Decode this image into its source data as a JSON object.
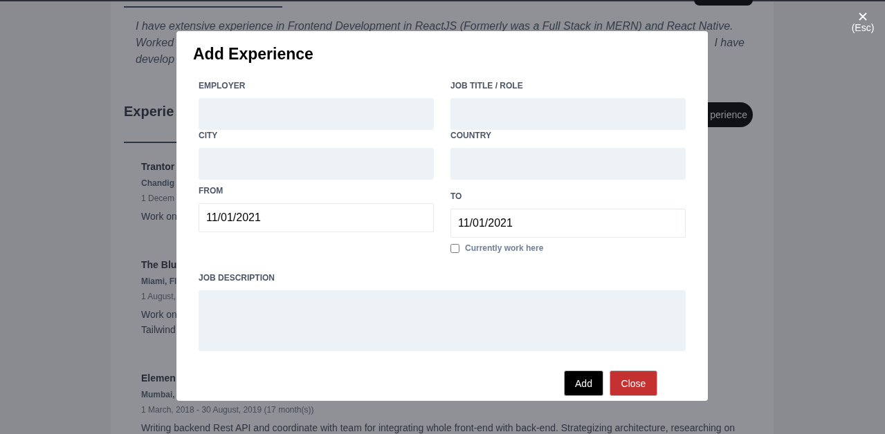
{
  "background_page": {
    "about_lines": [
      {
        "segments": [
          "I have extensive experience in Frontend Development in ReactJS (Formerly was a Full Stack in MERN) and React Native."
        ]
      },
      {
        "segments": [
          "Worked",
          "I have"
        ]
      },
      {
        "segments": [
          "develop"
        ]
      }
    ],
    "section_heading": "Experie",
    "add_button": "perience",
    "experiences": [
      {
        "company": "Trantor",
        "location": "Chandig",
        "dates": "1 Decem",
        "description_lines": [
          "Work on"
        ]
      },
      {
        "company": "The Blu",
        "location": "Miami, Fl",
        "dates": "1 August,",
        "description_lines": [
          "Work on",
          "Tailwind"
        ]
      },
      {
        "company": "Elemen",
        "location": "Mumbai,",
        "dates": "1 March, 2018 - 30 August, 2019 (17 month(s))",
        "description_lines": [
          "Writing backend Rest API and coordinate with team for integrating whole front-end with back-end. Strategizing architecture, researching on"
        ]
      }
    ]
  },
  "close_overlay": {
    "label": "(Esc)"
  },
  "modal": {
    "title": "Add Experience",
    "rows": [
      [
        {
          "label": "EMPLOYER",
          "kind": "text"
        },
        {
          "label": "JOB TITLE / ROLE",
          "kind": "text"
        }
      ],
      [
        {
          "label": "CITY",
          "kind": "text"
        },
        {
          "label": "COUNTRY",
          "kind": "text"
        }
      ],
      [
        {
          "label": "FROM",
          "kind": "date",
          "value": "11/01/2021"
        },
        {
          "label": "TO",
          "kind": "date",
          "value": "11/01/2021",
          "checkbox": {
            "label": "Currently work here",
            "checked": false
          }
        }
      ]
    ],
    "description": {
      "label": "JOB DESCRIPTION"
    },
    "buttons": [
      {
        "label": "Add",
        "kind": "primary"
      },
      {
        "label": "Close",
        "kind": "danger"
      }
    ]
  }
}
